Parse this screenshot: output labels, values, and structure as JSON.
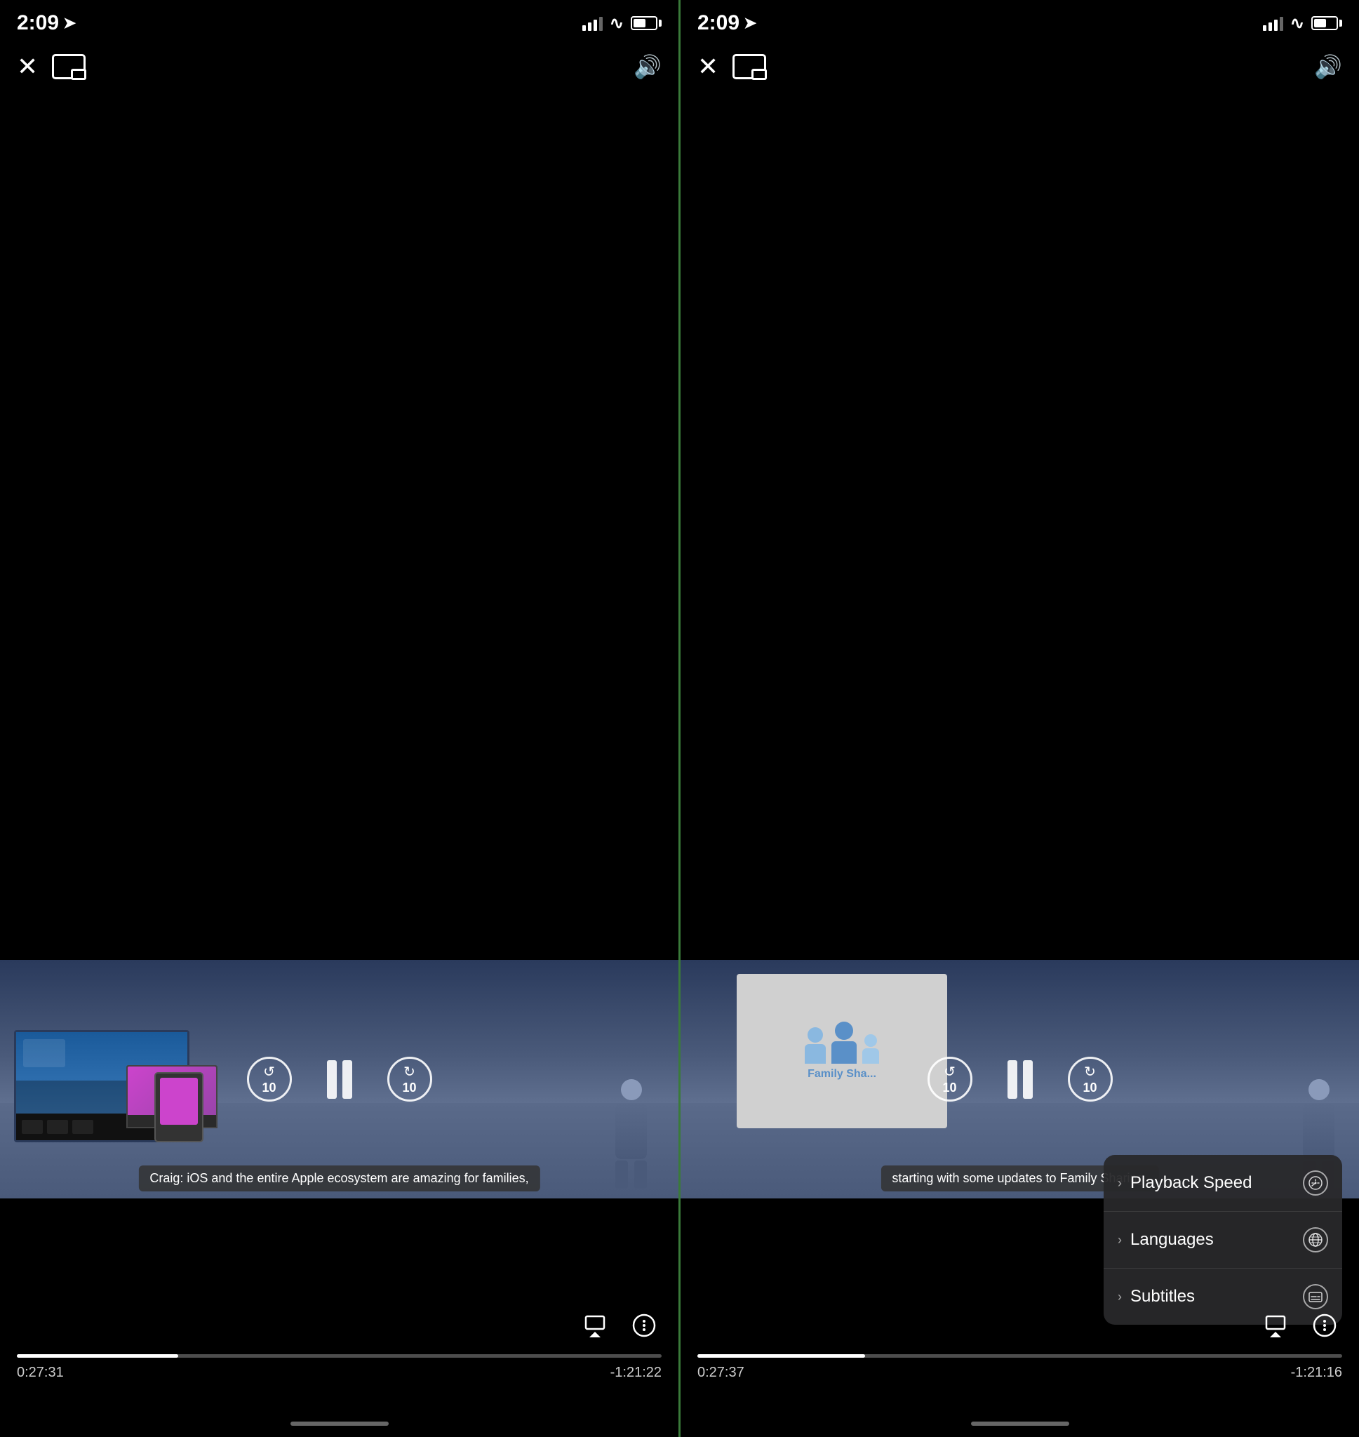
{
  "panels": [
    {
      "id": "left",
      "statusBar": {
        "time": "2:09",
        "locationArrow": "▲",
        "battery": "55"
      },
      "topControls": {
        "closeLabel": "×",
        "volumeLabel": "🔊"
      },
      "videoSubtitle": "Craig: iOS and the entire Apple ecosystem are amazing for families,",
      "skipBackLabel": "10",
      "skipForwardLabel": "10",
      "progressPercent": 25,
      "timeElapsed": "0:27:31",
      "timeRemaining": "-1:21:22"
    },
    {
      "id": "right",
      "statusBar": {
        "time": "2:09",
        "locationArrow": "▲",
        "battery": "55"
      },
      "topControls": {
        "closeLabel": "×",
        "volumeLabel": "🔊"
      },
      "videoSubtitle": "starting with some updates to Family Sharing.",
      "skipBackLabel": "10",
      "skipForwardLabel": "10",
      "progressPercent": 26,
      "timeElapsed": "0:27:37",
      "timeRemaining": "-1:21:16",
      "menu": {
        "items": [
          {
            "label": "Playback Speed",
            "icon": "speedometer"
          },
          {
            "label": "Languages",
            "icon": "globe"
          },
          {
            "label": "Subtitles",
            "icon": "subtitles"
          }
        ]
      }
    }
  ]
}
